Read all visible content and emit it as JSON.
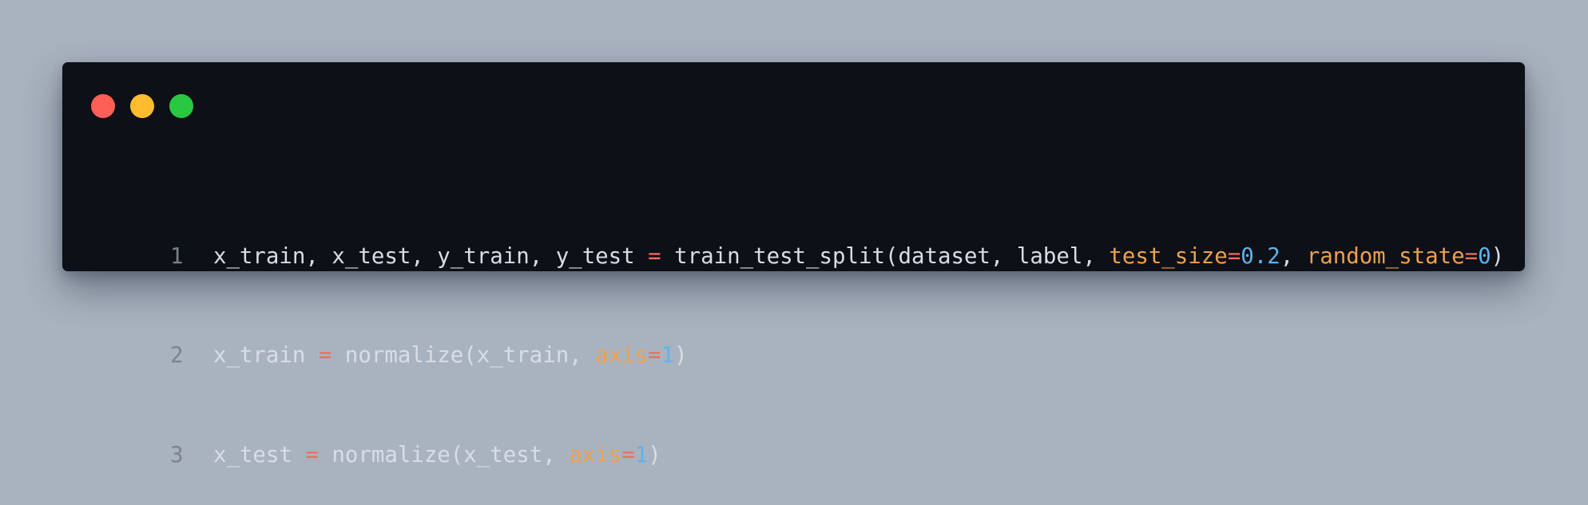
{
  "window": {
    "traffic_lights": [
      {
        "name": "close",
        "color": "#ff5f57"
      },
      {
        "name": "minimize",
        "color": "#febc2e"
      },
      {
        "name": "maximize",
        "color": "#28c840"
      }
    ]
  },
  "colors": {
    "background": "#a8b3bf",
    "editor_background": "#0d1017",
    "text": "#d8dde6",
    "line_number": "#7b828c",
    "operator": "#f06d5f",
    "keyword_argument": "#f0a04b",
    "number": "#5fb3f0"
  },
  "code": {
    "lines": [
      {
        "number": "1",
        "tokens": [
          {
            "t": "x_train, x_test, y_train, y_test ",
            "k": "txt"
          },
          {
            "t": "=",
            "k": "op"
          },
          {
            "t": " train_test_split(dataset, label, ",
            "k": "txt"
          },
          {
            "t": "test_size",
            "k": "kw"
          },
          {
            "t": "=",
            "k": "op"
          },
          {
            "t": "0.2",
            "k": "num"
          },
          {
            "t": ", ",
            "k": "txt"
          },
          {
            "t": "random_state",
            "k": "kw"
          },
          {
            "t": "=",
            "k": "op"
          },
          {
            "t": "0",
            "k": "num"
          },
          {
            "t": ")",
            "k": "txt"
          }
        ]
      },
      {
        "number": "2",
        "tokens": [
          {
            "t": "x_train ",
            "k": "txt"
          },
          {
            "t": "=",
            "k": "op"
          },
          {
            "t": " normalize(x_train, ",
            "k": "txt"
          },
          {
            "t": "axis",
            "k": "kw"
          },
          {
            "t": "=",
            "k": "op"
          },
          {
            "t": "1",
            "k": "num"
          },
          {
            "t": ")",
            "k": "txt"
          }
        ]
      },
      {
        "number": "3",
        "tokens": [
          {
            "t": "x_test ",
            "k": "txt"
          },
          {
            "t": "=",
            "k": "op"
          },
          {
            "t": " normalize(x_test, ",
            "k": "txt"
          },
          {
            "t": "axis",
            "k": "kw"
          },
          {
            "t": "=",
            "k": "op"
          },
          {
            "t": "1",
            "k": "num"
          },
          {
            "t": ")",
            "k": "txt"
          }
        ]
      }
    ]
  }
}
